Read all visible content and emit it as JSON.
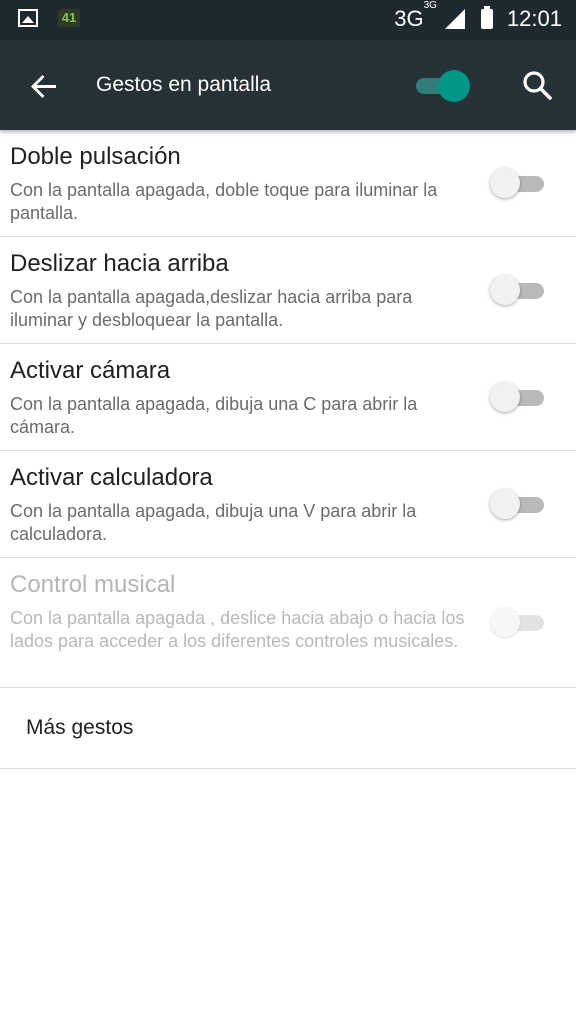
{
  "statusbar": {
    "notification_badge": "41",
    "network": "3G",
    "network_small": "3G",
    "time": "12:01",
    "icons": [
      "image-icon",
      "notification-app-icon",
      "signal-icon",
      "battery-icon"
    ]
  },
  "appbar": {
    "title": "Gestos en pantalla",
    "master_switch_on": true,
    "accent": "#009688",
    "background": "#263238"
  },
  "items": [
    {
      "title": "Doble pulsación",
      "desc": "Con la pantalla apagada, doble toque para iluminar la pantalla.",
      "checked": false,
      "enabled": true
    },
    {
      "title": "Deslizar hacia arriba",
      "desc": "Con la pantalla apagada,deslizar hacia arriba para iluminar y desbloquear la pantalla.",
      "checked": false,
      "enabled": true
    },
    {
      "title": "Activar cámara",
      "desc": "Con la pantalla apagada, dibuja una C para abrir la cámara.",
      "checked": false,
      "enabled": true
    },
    {
      "title": "Activar calculadora",
      "desc": "Con la pantalla apagada, dibuja una V para abrir la calculadora.",
      "checked": false,
      "enabled": true
    },
    {
      "title": "Control musical",
      "desc": "Con la pantalla apagada , deslice hacia abajo o hacia los lados para acceder a los diferentes controles musicales.",
      "checked": false,
      "enabled": false
    }
  ],
  "more": {
    "label": "Más gestos"
  }
}
